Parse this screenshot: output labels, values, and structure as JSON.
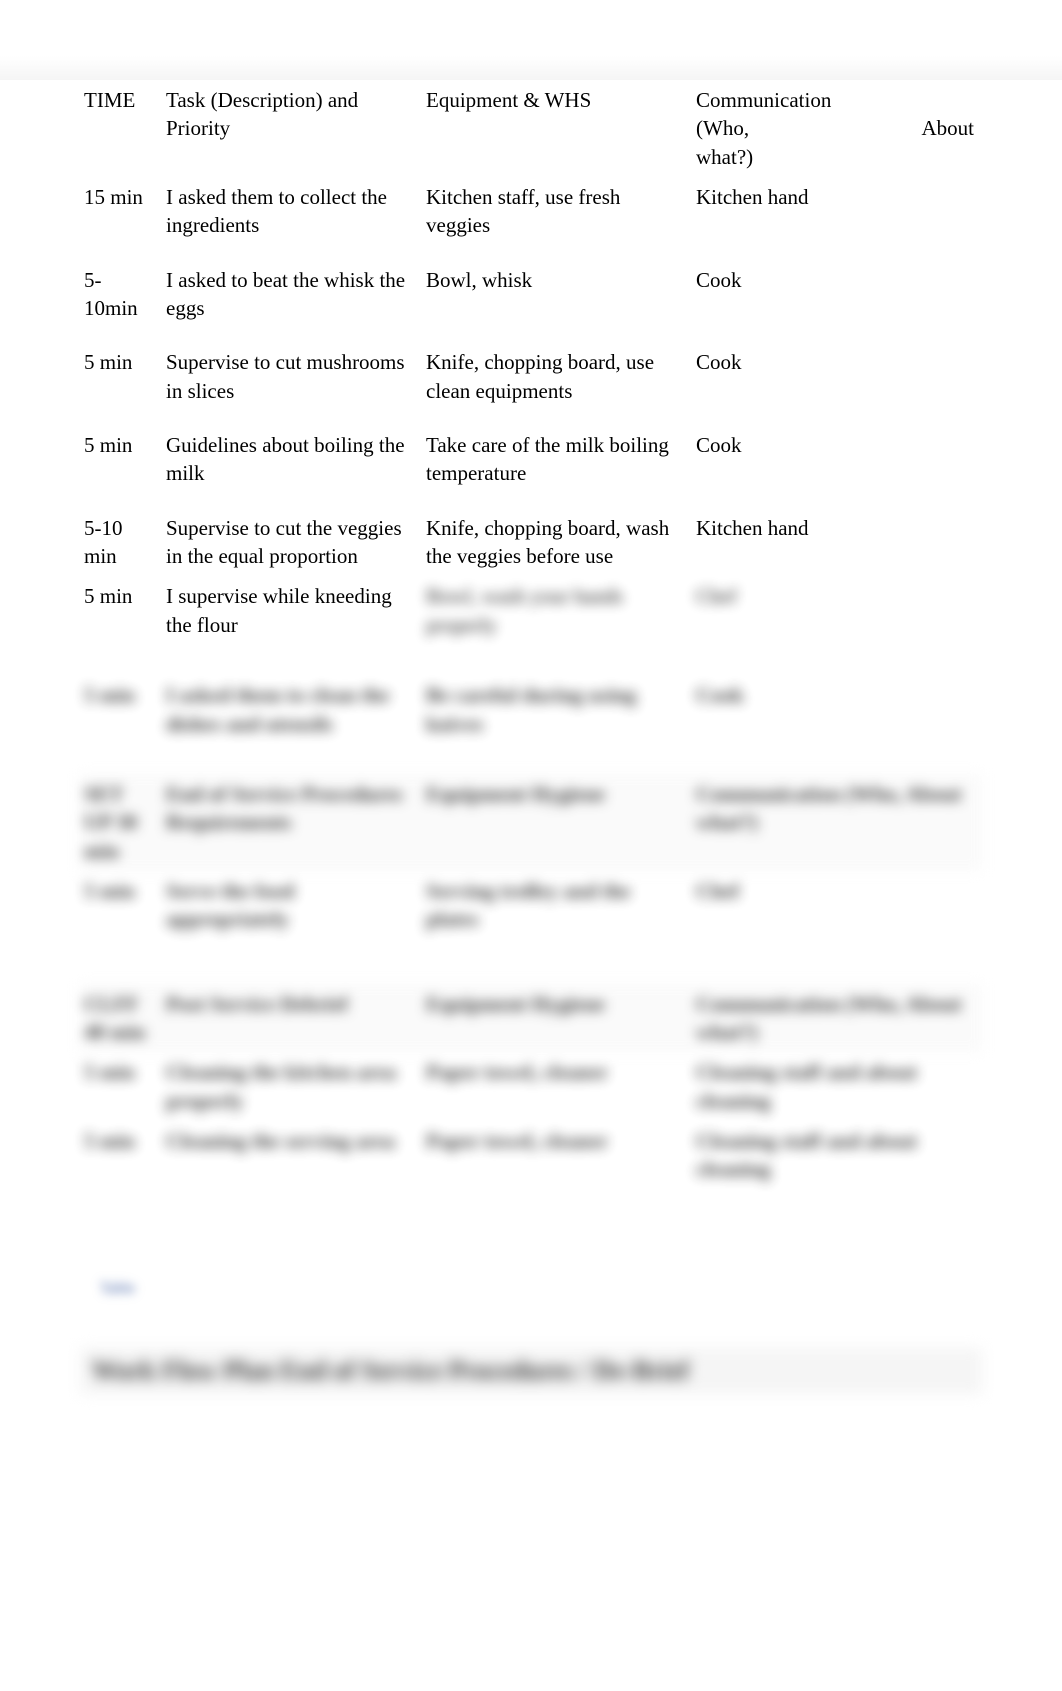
{
  "table1": {
    "headers": {
      "time": "TIME",
      "task": "Task (Description) and Priority",
      "equip": "Equipment & WHS",
      "comm_line1": "Communication",
      "comm_line2_left": "(Who,",
      "comm_line2_right": "About",
      "comm_line3": " what?)"
    },
    "rows": [
      {
        "time": "15 min",
        "task": "I asked them to collect the ingredients",
        "equip": "Kitchen staff, use fresh veggies",
        "comm": "Kitchen hand"
      },
      {
        "time": "5-10min",
        "task": "I asked to beat the whisk the eggs",
        "equip": "Bowl, whisk",
        "comm": "Cook"
      },
      {
        "time": "5 min",
        "task": "Supervise to cut mushrooms in slices",
        "equip": "Knife, chopping board, use clean equipments",
        "comm": "Cook"
      },
      {
        "time": "5 min",
        "task": "Guidelines about boiling the milk",
        "equip": "Take care of the milk boiling temperature",
        "comm": "Cook"
      },
      {
        "time": "5-10 min",
        "task": "Supervise to cut the veggies in the equal proportion",
        "equip": "Knife, chopping board, wash the veggies before use",
        "comm": "Kitchen hand"
      },
      {
        "time": "5 min",
        "task": "I supervise while kneeding the flour",
        "equip": "Bowl, wash your hands properly",
        "comm": "Chef"
      }
    ]
  },
  "table2_blur": {
    "rows": [
      {
        "time": "5 min",
        "task": "I asked them to clean the dishes and utensils",
        "equip": "Be careful during using knives",
        "comm": "Cook"
      }
    ]
  },
  "table3_blur": {
    "headers": {
      "time": "SET UP 30 min",
      "task": "End of Service Procedures Requirements",
      "equip": "Equipment Hygiene",
      "comm": "Communication (Who, About what?)"
    },
    "rows": [
      {
        "time": "5 min",
        "task": "Serve the food appropriately",
        "equip": "Serving trolley and the plates",
        "comm": "Chef"
      }
    ]
  },
  "table4_blur": {
    "headers": {
      "time": "CLFF 40 min",
      "task": "Post Service Debrief",
      "equip": "Equipment Hygiene",
      "comm": "Communication (Who, About what?)"
    },
    "rows": [
      {
        "time": "5 min",
        "task": "Cleaning the kitchen area properly",
        "equip": "Paper towel, cleaner",
        "comm": "Cleaning staff and about cleaning"
      },
      {
        "time": "5 min",
        "task": "Cleaning the serving area",
        "equip": "Paper towel, cleaner",
        "comm": "Cleaning staff and about cleaning"
      }
    ]
  },
  "footer_small": "Table",
  "footer_heading": "Work Flow Plan End of Service Procedures / De-Brief"
}
